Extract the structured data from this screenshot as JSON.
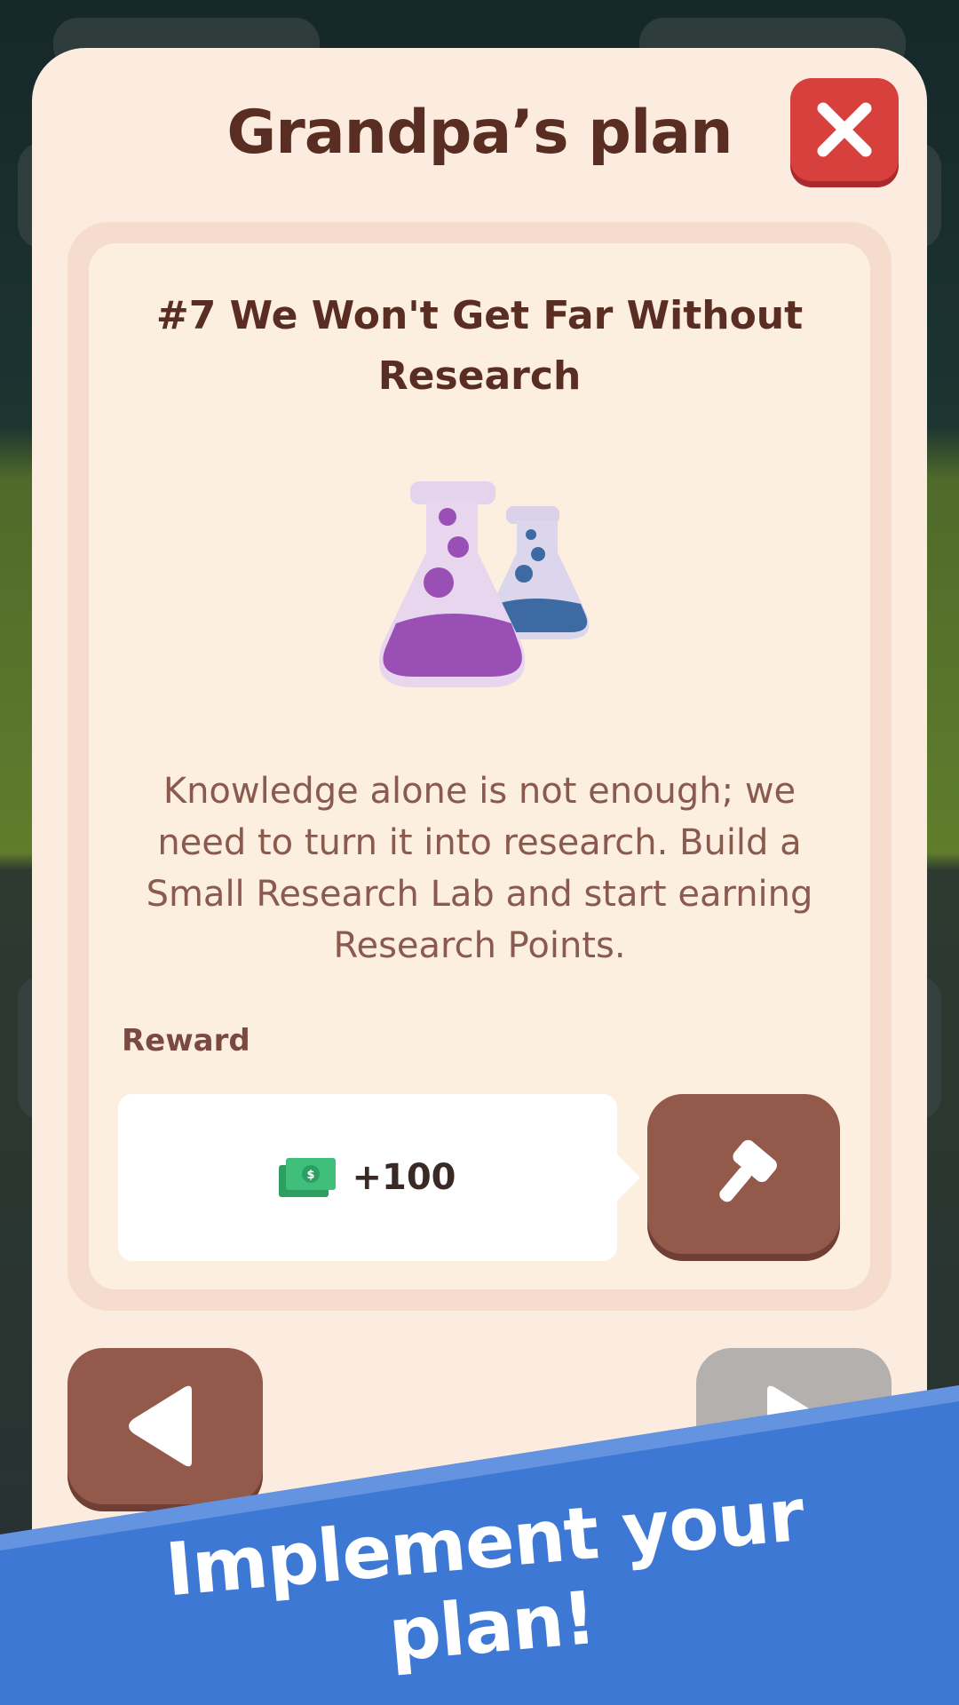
{
  "modal": {
    "title": "Grandpa’s plan",
    "close_icon": "close-x-icon"
  },
  "quest": {
    "title": "#7 We Won't Get Far Without Research",
    "icon": "research-flasks-icon",
    "description": "Knowledge alone is not enough; we need to turn it into research. Build a Small Research Lab and start earning Research Points."
  },
  "reward": {
    "label": "Reward",
    "icon": "cash-icon",
    "value": "+100"
  },
  "actions": {
    "build_icon": "hammer-icon",
    "prev_icon": "arrow-left-icon",
    "next_icon": "arrow-right-icon",
    "next_enabled": false
  },
  "banner": {
    "text": "Implement your plan!"
  },
  "colors": {
    "modal_bg": "#fcecdf",
    "title": "#5a2d23",
    "close": "#d8403e",
    "button_brown": "#93594b",
    "banner_blue": "#3d78d4"
  }
}
